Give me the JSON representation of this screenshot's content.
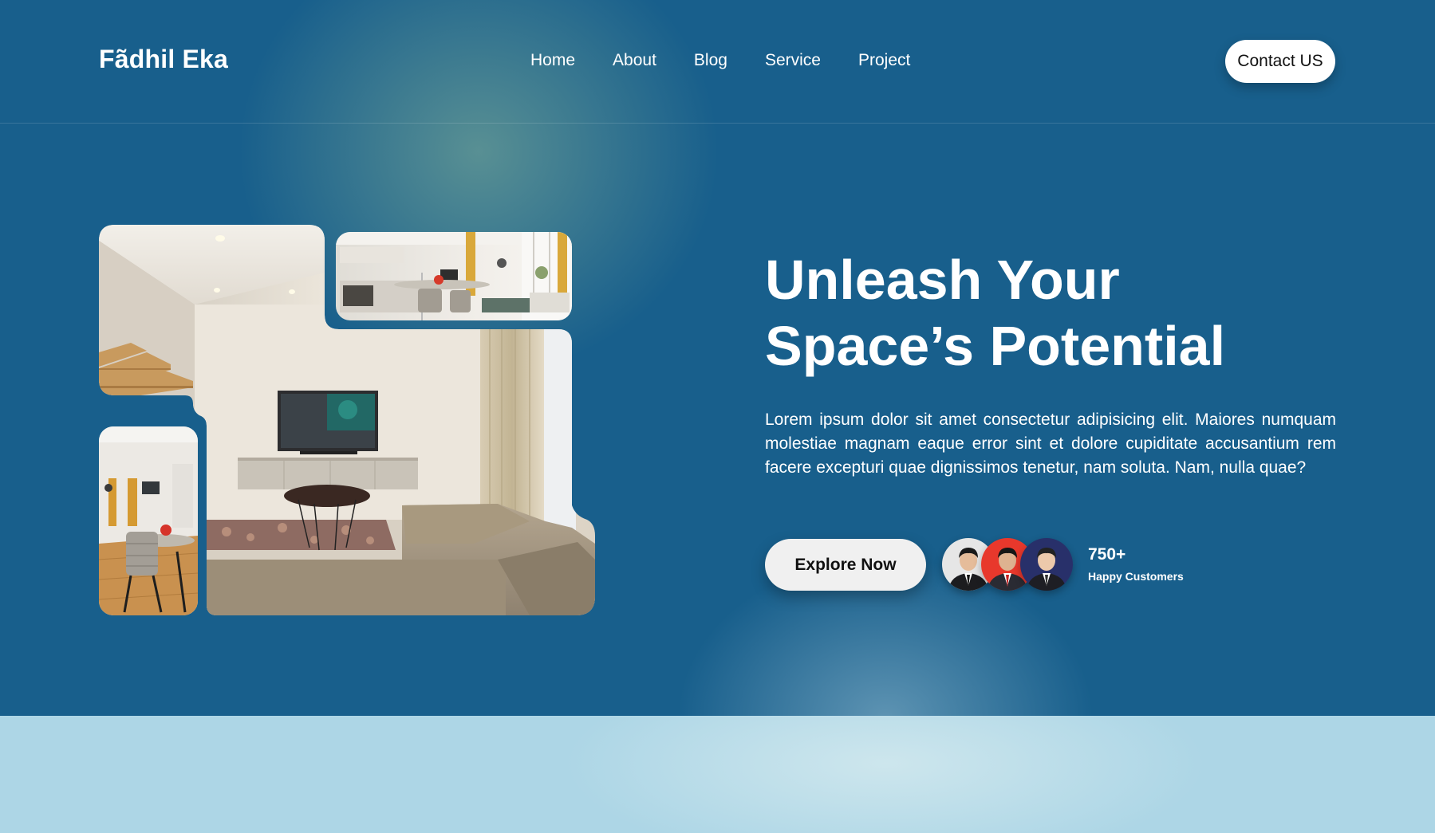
{
  "brand": {
    "name": "Fãdhil Eka"
  },
  "nav": {
    "items": [
      {
        "label": "Home"
      },
      {
        "label": "About"
      },
      {
        "label": "Blog"
      },
      {
        "label": "Service"
      },
      {
        "label": "Project"
      }
    ],
    "contact_label": "Contact US"
  },
  "hero": {
    "headline_line1": "Unleash Your",
    "headline_line2": "Space’s Potential",
    "description": "Lorem ipsum dolor sit amet consectetur adipisicing elit. Maiores numquam molestiae magnam eaque error sint et dolore cupiditate accusantium rem facere excepturi quae dignissimos tenetur, nam soluta. Nam, nulla quae?",
    "cta_label": "Explore Now",
    "stats_count": "750+",
    "stats_caption": "Happy Customers"
  },
  "colors": {
    "hero_background": "#185f8c",
    "lower_band": "#add6e6",
    "button_background": "#ffffff",
    "text": "#ffffff"
  },
  "gallery": {
    "images": [
      "living-room-photo",
      "kitchen-dining-photo",
      "dining-chair-photo"
    ]
  },
  "avatars": [
    "customer-avatar-1",
    "customer-avatar-2",
    "customer-avatar-3"
  ]
}
